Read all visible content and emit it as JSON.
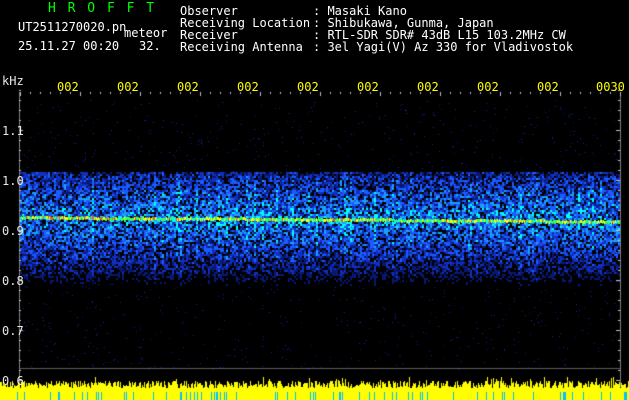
{
  "header": {
    "brand": "H R O F F T",
    "filename": "UT2511270020.pn",
    "mode": "meteor",
    "datetime": "25.11.27 00:20",
    "channel": "32.",
    "observer_label": "Observer",
    "observer_value": ": Masaki Kano",
    "location_label": "Receiving Location",
    "location_value": ": Shibukawa, Gunma, Japan",
    "receiver_label": "Receiver",
    "receiver_value": ": RTL-SDR SDR# 43dB L15 103.2MHz CW",
    "antenna_label": "Receiving Antenna",
    "antenna_value": ": 3el Yagi(V) Az 330 for Vladivostok"
  },
  "axes": {
    "y_unit": "kHz",
    "y_ticks": [
      "1.1",
      "1.0",
      "0.9",
      "0.8",
      "0.7",
      "0.6"
    ],
    "x_ticks": [
      "002",
      "002",
      "002",
      "002",
      "002",
      "002",
      "002",
      "002",
      "002",
      "0030"
    ]
  },
  "colors": {
    "brand": "#00ff00",
    "header_text": "#ffffff",
    "axis_text": "#e8e8e8",
    "time_ticks": "#ffff00",
    "signal_trace": "#ffff00"
  }
}
